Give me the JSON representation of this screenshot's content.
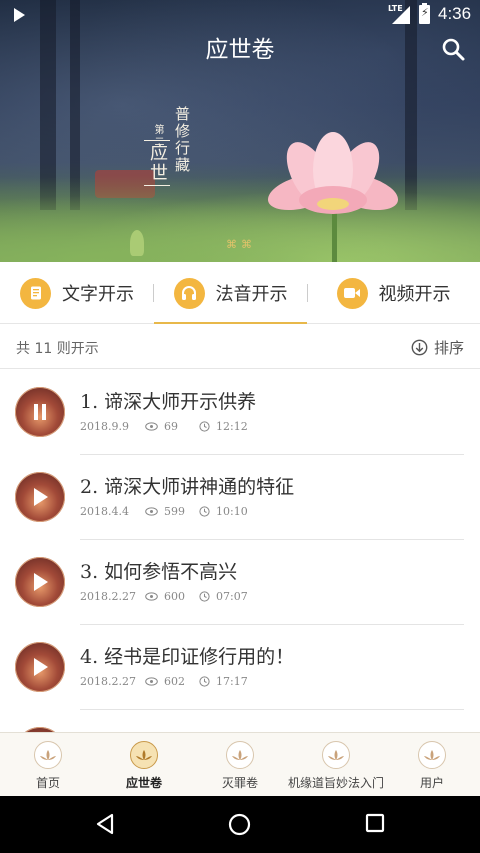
{
  "status_bar": {
    "network": "LTE",
    "time": "4:36",
    "play_icon": "play-indicator-icon"
  },
  "header": {
    "title": "应世卷",
    "search_icon": "search-icon"
  },
  "banner": {
    "line1": "普修行藏",
    "line2": "第二",
    "line3": "应世"
  },
  "tabs": [
    {
      "label": "文字开示",
      "icon": "document-icon",
      "active": false
    },
    {
      "label": "法音开示",
      "icon": "headphones-icon",
      "active": true
    },
    {
      "label": "视频开示",
      "icon": "video-camera-icon",
      "active": false
    }
  ],
  "summary": {
    "count_text": "共 11 则开示",
    "sort_label": "排序"
  },
  "items": [
    {
      "title": "1. 谛深大师开示供养",
      "date": "2018.9.9",
      "views": "69",
      "duration": "12:12",
      "state": "playing"
    },
    {
      "title": "2. 谛深大师讲神通的特征",
      "date": "2018.4.4",
      "views": "599",
      "duration": "10:10",
      "state": "paused"
    },
    {
      "title": "3. 如何参悟不高兴",
      "date": "2018.2.27",
      "views": "600",
      "duration": "07:07",
      "state": "paused"
    },
    {
      "title": "4. 经书是印证修行用的！",
      "date": "2018.2.27",
      "views": "602",
      "duration": "17:17",
      "state": "paused"
    }
  ],
  "bottom_nav": [
    {
      "label": "首页",
      "active": false
    },
    {
      "label": "应世卷",
      "active": true
    },
    {
      "label": "灭罪卷",
      "active": false
    },
    {
      "label": "机缘道旨妙法入门",
      "active": false
    },
    {
      "label": "用户",
      "active": false
    }
  ],
  "colors": {
    "accent": "#f3b640",
    "underline": "#e8b84a",
    "text_primary": "#333333",
    "text_meta": "#888888"
  }
}
